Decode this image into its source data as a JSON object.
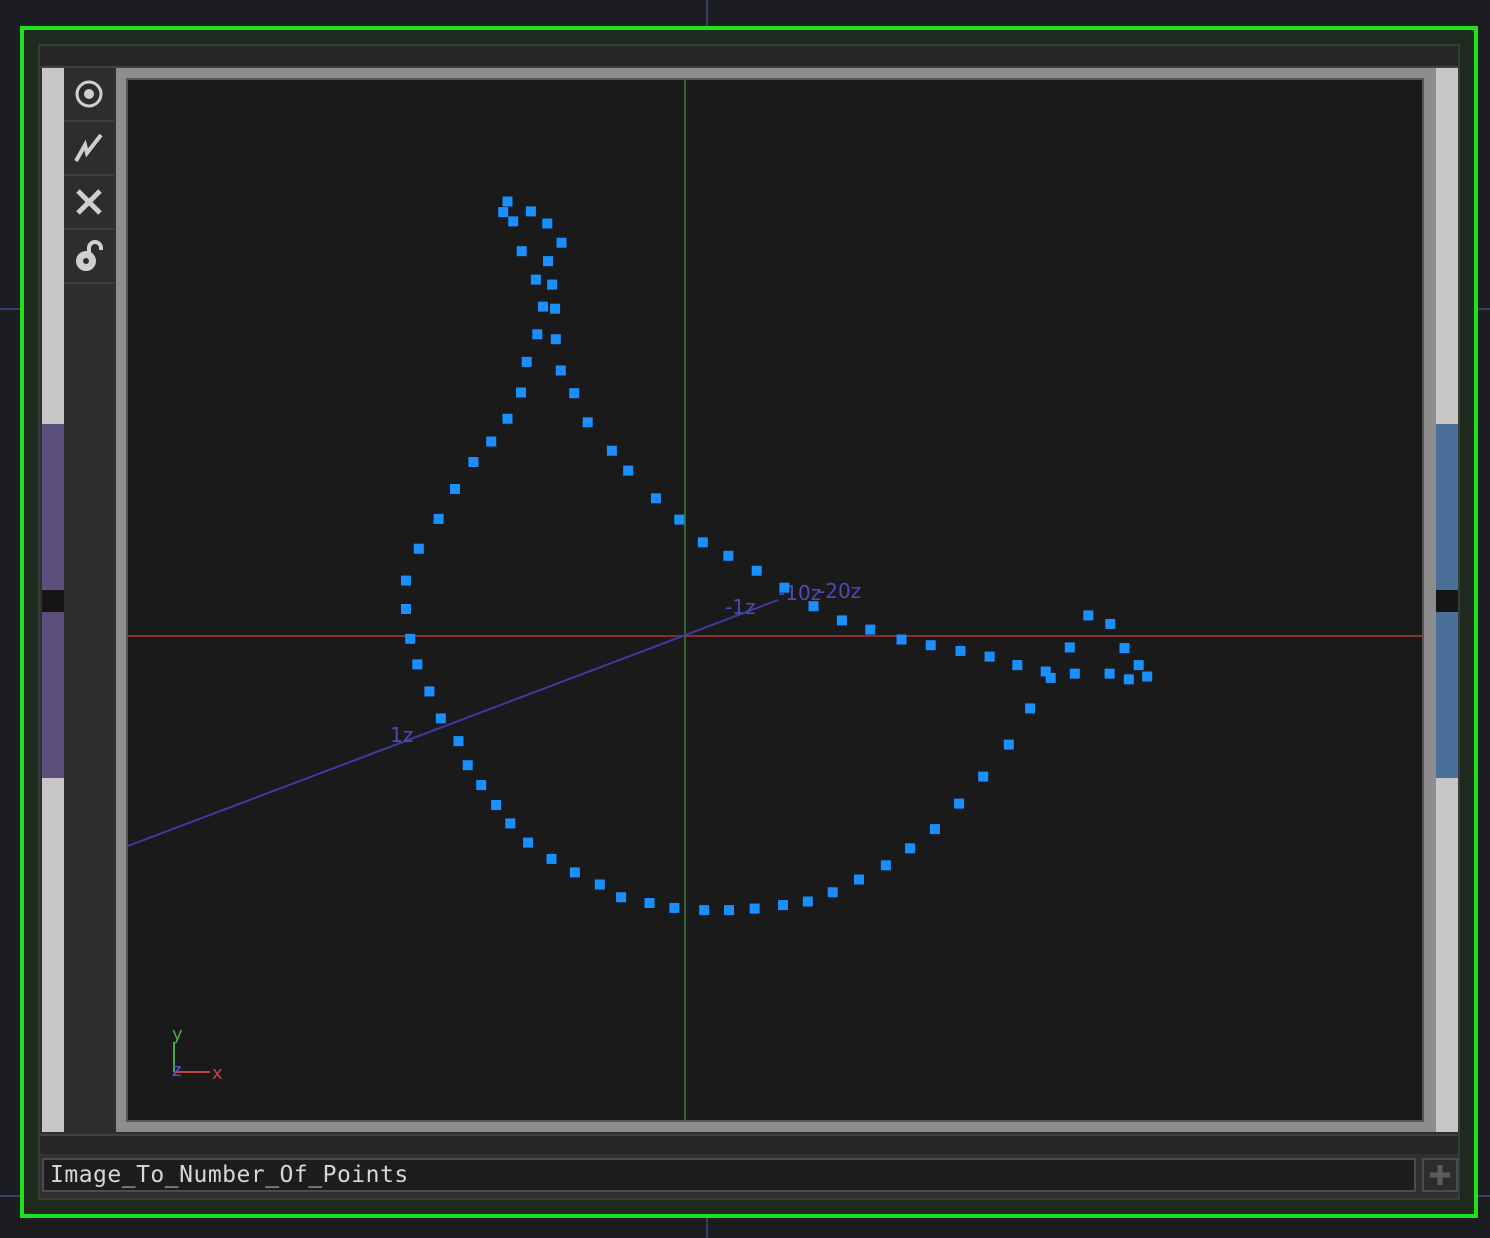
{
  "node": {
    "name": "Image_To_Number_Of_Points"
  },
  "toolbar": {
    "items": [
      {
        "icon": "target-icon"
      },
      {
        "icon": "viewer-active-icon"
      },
      {
        "icon": "close-icon"
      },
      {
        "icon": "lock-open-icon"
      }
    ]
  },
  "viewport": {
    "axis_labels": {
      "x": "x",
      "y": "y",
      "z": "z"
    },
    "z_ticks": [
      "-1z",
      "-10z",
      "-20z",
      "1z"
    ],
    "colors": {
      "point": "#1a8fff",
      "x_axis": "#8a2e2e",
      "y_axis": "#2e6a2e",
      "z_axis": "#3d3aa0",
      "node_border": "#1fe21f"
    }
  },
  "chart_data": {
    "type": "scatter",
    "description_axes": "viewport world units (approx)",
    "x": [
      -2.56,
      -2.17,
      -1.94,
      -1.74,
      -1.93,
      -1.87,
      -2.0,
      -2.08,
      -2.23,
      -2.31,
      -2.5,
      -2.73,
      -2.98,
      -3.24,
      -3.47,
      -3.75,
      -3.93,
      -3.93,
      -3.87,
      -3.77,
      -3.6,
      -3.44,
      -3.19,
      -3.06,
      -2.87,
      -2.66,
      -2.46,
      -2.21,
      -1.88,
      -1.55,
      -1.2,
      -0.9,
      -0.5,
      -0.15,
      0.27,
      0.62,
      0.98,
      1.38,
      1.73,
      2.08,
      2.45,
      2.83,
      3.17,
      3.52,
      3.86,
      4.2,
      4.56,
      4.86,
      5.15,
      5.42,
      5.68,
      5.99,
      6.19,
      6.39,
      6.51,
      6.25,
      5.98,
      5.49,
      5.08,
      4.68,
      4.29,
      3.88,
      3.46,
      3.05,
      2.61,
      2.21,
      1.81,
      1.4,
      1.01,
      0.61,
      0.25,
      -0.08,
      -0.41,
      -0.8,
      -1.03,
      -1.37,
      -1.56,
      -1.75,
      -1.82,
      -1.83,
      -2.1,
      -2.3,
      -2.42,
      -2.5
    ],
    "y": [
      5.97,
      5.98,
      5.81,
      5.54,
      5.28,
      4.95,
      4.64,
      4.25,
      3.86,
      3.43,
      3.06,
      2.74,
      2.45,
      2.07,
      1.65,
      1.23,
      0.78,
      0.38,
      -0.04,
      -0.4,
      -0.78,
      -1.16,
      -1.48,
      -1.82,
      -2.1,
      -2.38,
      -2.64,
      -2.91,
      -3.14,
      -3.33,
      -3.5,
      -3.68,
      -3.76,
      -3.83,
      -3.86,
      -3.86,
      -3.84,
      -3.79,
      -3.74,
      -3.61,
      -3.43,
      -3.23,
      -2.99,
      -2.72,
      -2.36,
      -1.98,
      -1.53,
      -1.02,
      -0.59,
      -0.16,
      0.29,
      0.17,
      -0.17,
      -0.41,
      -0.57,
      -0.61,
      -0.53,
      -0.53,
      -0.5,
      -0.41,
      -0.29,
      -0.21,
      -0.13,
      -0.05,
      0.09,
      0.22,
      0.42,
      0.68,
      0.92,
      1.13,
      1.32,
      1.64,
      1.94,
      2.33,
      2.61,
      3.01,
      3.42,
      3.74,
      4.18,
      4.61,
      5.02,
      5.42,
      5.84,
      6.12
    ]
  }
}
